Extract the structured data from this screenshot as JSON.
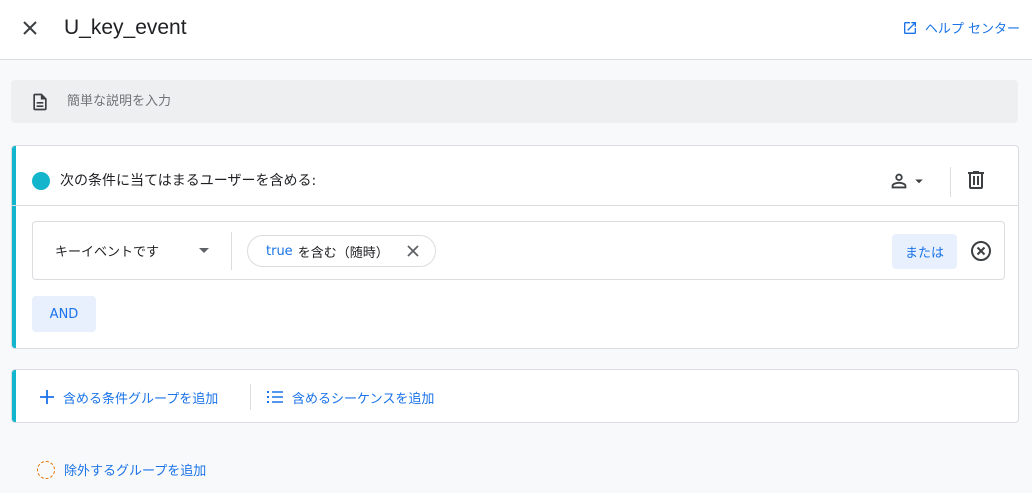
{
  "header": {
    "title": "U_key_event",
    "help_label": "ヘルプ センター"
  },
  "description": {
    "placeholder": "簡単な説明を入力",
    "value": ""
  },
  "include_group": {
    "title": "次の条件に当てはまるユーザーを含める:",
    "scope_icon": "person-icon",
    "condition": {
      "dimension": "キーイベントです",
      "chip_value": "true",
      "chip_operator": "を含む（随時）",
      "or_label": "または"
    },
    "and_label": "AND"
  },
  "add_actions": {
    "add_condition_group": "含める条件グループを追加",
    "add_sequence": "含めるシーケンスを追加"
  },
  "exclude_action": {
    "label": "除外するグループを追加"
  },
  "colors": {
    "accent": "#12b5cb",
    "link": "#1a73e8",
    "chip_bg": "#e8f0fe",
    "exclude": "#e37400"
  }
}
